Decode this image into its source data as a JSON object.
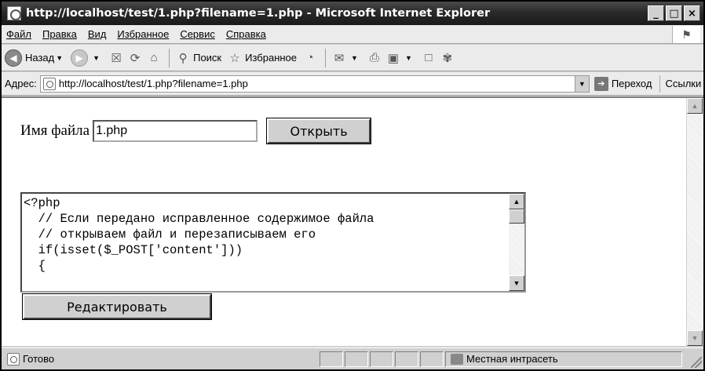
{
  "window": {
    "title": "http://localhost/test/1.php?filename=1.php - Microsoft Internet Explorer",
    "minimize": "_",
    "maximize": "□",
    "close": "×"
  },
  "menu": {
    "items": [
      {
        "label": "Файл"
      },
      {
        "label": "Правка"
      },
      {
        "label": "Вид"
      },
      {
        "label": "Избранное"
      },
      {
        "label": "Сервис"
      },
      {
        "label": "Справка"
      }
    ]
  },
  "toolbar": {
    "back_label": "Назад",
    "search_label": "Поиск",
    "favorites_label": "Избранное"
  },
  "address": {
    "label": "Адрес:",
    "url": "http://localhost/test/1.php?filename=1.php",
    "go_label": "Переход",
    "links_label": "Ссылки"
  },
  "page": {
    "filename_label": "Имя файла",
    "filename_value": "1.php",
    "open_button": "Открыть",
    "code": "<?php\n  // Если передано исправленное содержимое файла\n  // открываем файл и перезаписываем его\n  if(isset($_POST['content']))\n  {",
    "edit_button": "Редактировать"
  },
  "status": {
    "text": "Готово",
    "zone": "Местная интрасеть"
  }
}
